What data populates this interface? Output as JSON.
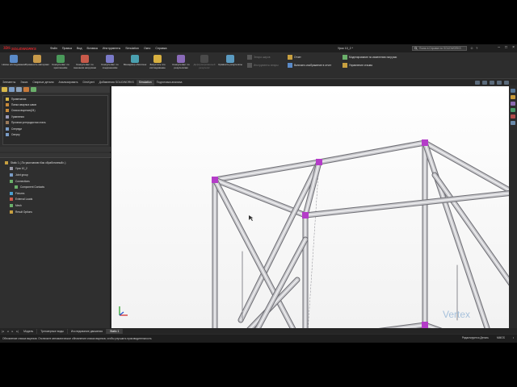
{
  "app": {
    "brand_prefix": "3DS",
    "brand_name": "SOLIDWORKS",
    "menu": [
      "Файл",
      "Правка",
      "Вид",
      "Вставка",
      "Инструменты",
      "Simulation",
      "Окно",
      "Справка"
    ],
    "document_title": "Урок 10_2 *",
    "help_search_placeholder": "Поиск в Справке по SOLIDWORKS",
    "window_controls": [
      "–",
      "□",
      "×"
    ]
  },
  "ribbon": {
    "big_buttons": [
      {
        "label": "Новое исследование",
        "icon": "new-study-icon"
      },
      {
        "label": "Применить материал",
        "icon": "apply-material-icon"
      },
      {
        "label": "Консультант по креплениям",
        "icon": "fixtures-advisor-icon"
      },
      {
        "label": "Консультант по внешним нагрузкам",
        "icon": "external-loads-advisor-icon"
      },
      {
        "label": "Консультант по соединениям",
        "icon": "connections-advisor-icon"
      },
      {
        "label": "Менеджер оболочек",
        "icon": "shell-manager-icon"
      },
      {
        "label": "Запустить это исследование",
        "icon": "run-study-icon"
      },
      {
        "label": "Консультант по результатам",
        "icon": "results-advisor-icon"
      },
      {
        "label": "Деформированный результат",
        "icon": "deformed-result-icon",
        "dim": true
      },
      {
        "label": "Сравнить результаты",
        "icon": "compare-results-icon"
      }
    ],
    "small_buttons": [
      {
        "label": "Эпюра шаров",
        "icon": "plot-icon",
        "dim": true
      },
      {
        "label": "Инструменты эпюры",
        "icon": "plot-tools-icon",
        "dim": true
      },
      {
        "label": "Отчет",
        "icon": "report-icon"
      },
      {
        "label": "Включить изображение в отчет",
        "icon": "include-image-icon"
      },
      {
        "label": "Моделирование по изменению нагрузки",
        "icon": "load-case-icon"
      },
      {
        "label": "Управление отзыва",
        "icon": "feedback-icon"
      }
    ]
  },
  "command_tabs": [
    {
      "label": "Элементы",
      "active": false
    },
    {
      "label": "Эскиз",
      "active": false
    },
    {
      "label": "Сварные детали",
      "active": false
    },
    {
      "label": "Анализировать",
      "active": false
    },
    {
      "label": "DimXpert",
      "active": false
    },
    {
      "label": "Добавления SOLIDWORKS",
      "active": false
    },
    {
      "label": "Simulation",
      "active": true
    },
    {
      "label": "Подготовка анализа",
      "active": false
    }
  ],
  "feature_tree": [
    {
      "label": "Примечания",
      "icon": "annotations-icon"
    },
    {
      "label": "Папка сварных швов",
      "icon": "weld-folder-icon"
    },
    {
      "label": "Список вырезов(24)",
      "icon": "cut-list-icon"
    },
    {
      "label": "Уравнения",
      "icon": "equations-icon"
    },
    {
      "label": "Прочная углеродистая сталь",
      "icon": "material-icon"
    },
    {
      "label": "Спереди",
      "icon": "plane-icon"
    },
    {
      "label": "Сверху",
      "icon": "plane-icon"
    }
  ],
  "simulation_tree": [
    {
      "label": "Static 1 (-По умолчанию<Как обработанный>-)",
      "icon": "study-icon",
      "indent": 0
    },
    {
      "label": "Урок 10_2",
      "icon": "part-icon",
      "indent": 1
    },
    {
      "label": "Joint group",
      "icon": "joint-group-icon",
      "indent": 1
    },
    {
      "label": "Connections",
      "icon": "connections-icon",
      "indent": 1
    },
    {
      "label": "Component Contacts",
      "icon": "contacts-icon",
      "indent": 2
    },
    {
      "label": "Fixtures",
      "icon": "fixtures-icon",
      "indent": 1
    },
    {
      "label": "External Loads",
      "icon": "loads-icon",
      "indent": 1
    },
    {
      "label": "Mesh",
      "icon": "mesh-icon",
      "indent": 1
    },
    {
      "label": "Result Options",
      "icon": "result-options-icon",
      "indent": 1
    }
  ],
  "bottom_tabs": [
    {
      "label": "Модель",
      "active": false
    },
    {
      "label": "Трехмерные виды",
      "active": false
    },
    {
      "label": "Исследование движения",
      "active": false
    },
    {
      "label": "Static 1",
      "active": true
    }
  ],
  "status": {
    "message": "Обновление списка вырезов. Отключите автоматическое обновление списка вырезов, чтобы улучшить производительность",
    "editing": "Редактируется Деталь",
    "units": "MMGS",
    "extra": "•"
  },
  "watermark": {
    "text": "Vertex"
  },
  "colors": {
    "joint": "#b43cc8",
    "beam_light": "#c8c8cc",
    "beam_dark": "#6e6e74",
    "accent": "#e0282c"
  }
}
